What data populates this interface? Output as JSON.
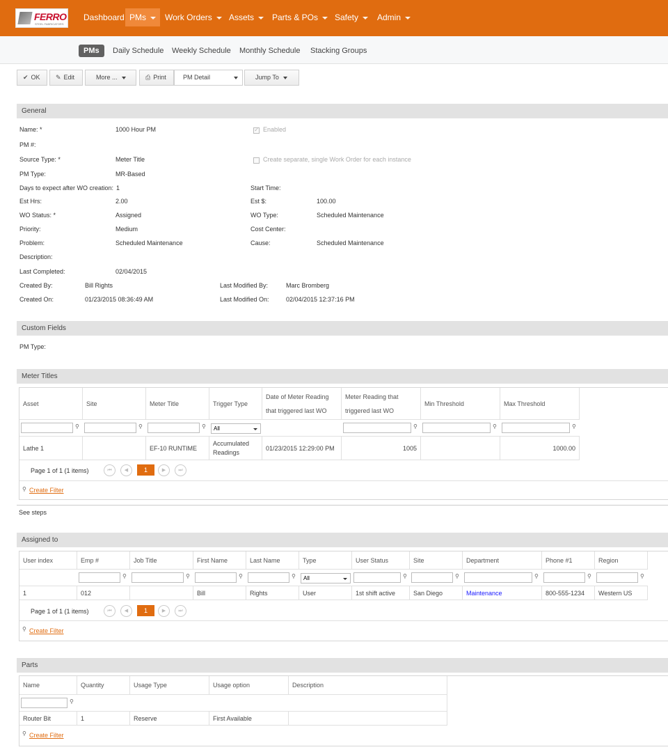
{
  "brand": {
    "logo_text": "FERRO",
    "logo_sub": "STEEL FABRICATORS",
    "accent": "#e06c10"
  },
  "nav": [
    {
      "label": "Dashboard",
      "dropdown": false
    },
    {
      "label": "PMs",
      "dropdown": true,
      "active": true
    },
    {
      "label": "Work Orders",
      "dropdown": true
    },
    {
      "label": "Assets",
      "dropdown": true
    },
    {
      "label": "Parts & POs",
      "dropdown": true
    },
    {
      "label": "Safety",
      "dropdown": true
    },
    {
      "label": "Admin",
      "dropdown": true
    }
  ],
  "subnav": [
    "PMs",
    "Daily Schedule",
    "Weekly Schedule",
    "Monthly Schedule",
    "Stacking Groups"
  ],
  "toolbar": {
    "ok": "OK",
    "edit": "Edit",
    "more": "More ...",
    "print": "Print",
    "print_select": "PM Detail",
    "jump": "Jump To"
  },
  "general": {
    "title": "General",
    "name_label": "Name: *",
    "name": "1000 Hour PM",
    "enabled_label": "Enabled",
    "pm_num_label": "PM #:",
    "source_type_label": "Source Type: *",
    "source_type": "Meter Title",
    "separate_wo_label": "Create separate, single Work Order for each instance",
    "pm_type_label": "PM Type:",
    "pm_type": "MR-Based",
    "days_label": "Days to expect after WO creation:",
    "days": "1",
    "start_time_label": "Start Time:",
    "est_hrs_label": "Est Hrs:",
    "est_hrs": "2.00",
    "est_cost_label": "Est $:",
    "est_cost": "100.00",
    "wo_status_label": "WO Status: *",
    "wo_status": "Assigned",
    "wo_type_label": "WO Type:",
    "wo_type": "Scheduled Maintenance",
    "priority_label": "Priority:",
    "priority": "Medium",
    "cost_center_label": "Cost Center:",
    "problem_label": "Problem:",
    "problem": "Scheduled Maintenance",
    "cause_label": "Cause:",
    "cause": "Scheduled Maintenance",
    "description_label": "Description:",
    "last_completed_label": "Last Completed:",
    "last_completed": "02/04/2015",
    "created_by_label": "Created By:",
    "created_by": "Bill Rights",
    "modified_by_label": "Last Modified By:",
    "modified_by": "Marc Bromberg",
    "created_on_label": "Created On:",
    "created_on": "01/23/2015 08:36:49 AM",
    "modified_on_label": "Last Modified On:",
    "modified_on": "02/04/2015 12:37:16 PM"
  },
  "custom_fields": {
    "title": "Custom Fields",
    "pm_type_label": "PM Type:"
  },
  "meter_titles": {
    "title": "Meter Titles",
    "headers": [
      "Asset",
      "Site",
      "Meter Title",
      "Trigger Type",
      "Date of Meter Reading that triggered last WO",
      "Meter Reading that triggered last WO",
      "Min Threshold",
      "Max Threshold"
    ],
    "filter_select": "All",
    "row": [
      "Lathe 1",
      "",
      "EF-10 RUNTIME",
      "Accumulated Readings",
      "01/23/2015 12:29:00 PM",
      "1005",
      "",
      "1000.00"
    ],
    "pager": "Page 1 of 1 (1 items)",
    "page": "1",
    "create_filter": "Create Filter"
  },
  "see_steps": "See steps",
  "assigned_to": {
    "title": "Assigned to",
    "headers": [
      "User index",
      "Emp #",
      "Job Title",
      "First Name",
      "Last Name",
      "Type",
      "User Status",
      "Site",
      "Department",
      "Phone #1",
      "Region"
    ],
    "filter_select": "All",
    "row": [
      "1",
      "012",
      "",
      "Bill",
      "Rights",
      "User",
      "1st shift active",
      "San Diego",
      "Maintenance",
      "800-555-1234",
      "Western US"
    ],
    "pager": "Page 1 of 1 (1 items)",
    "page": "1",
    "create_filter": "Create Filter"
  },
  "parts": {
    "title": "Parts",
    "headers": [
      "Name",
      "Quantity",
      "Usage Type",
      "Usage option",
      "Description"
    ],
    "row": [
      "Router Bit",
      "1",
      "Reserve",
      "First Available",
      ""
    ],
    "create_filter": "Create Filter"
  }
}
